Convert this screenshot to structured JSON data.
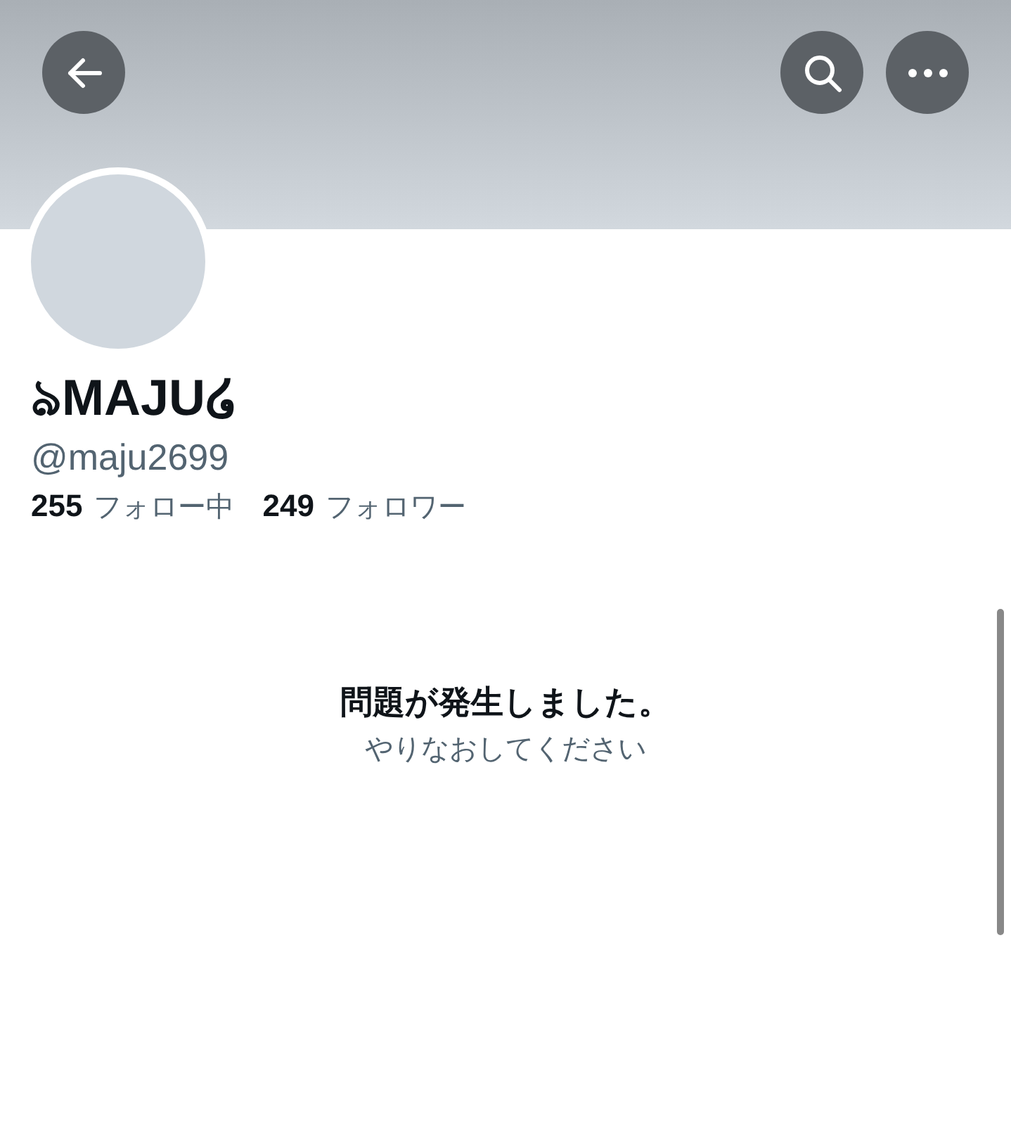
{
  "profile": {
    "name": "ঌMAJU໒",
    "handle": "@maju2699",
    "stats": [
      {
        "count": "255",
        "label": "フォロー中"
      },
      {
        "count": "249",
        "label": "フォロワー"
      }
    ]
  },
  "error": {
    "title": "問題が発生しました。",
    "hint": "やりなおしてください"
  }
}
